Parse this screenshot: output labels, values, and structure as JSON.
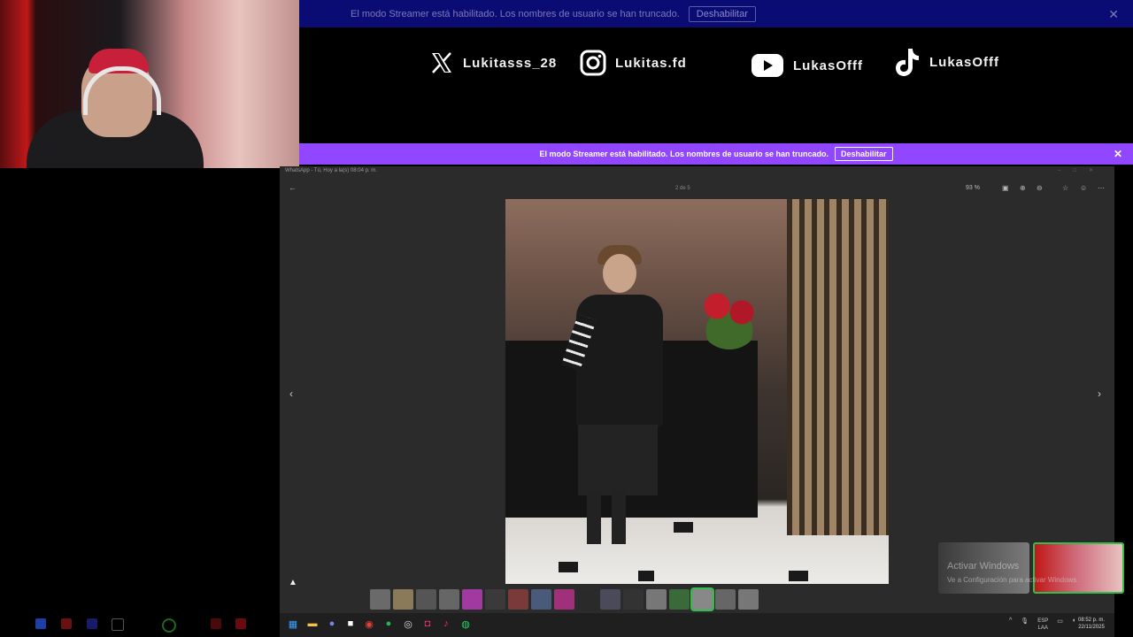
{
  "top_banner": {
    "text": "El modo Streamer está habilitado. Los nombres de usuario se han truncado.",
    "button": "Deshabilitar",
    "close": "✕"
  },
  "socials": [
    {
      "icon": "x-logo-icon",
      "label": "Lukitasss_28"
    },
    {
      "icon": "instagram-icon",
      "label": "Lukitas.fd"
    },
    {
      "icon": "youtube-icon",
      "label": "LukasOfff"
    },
    {
      "icon": "tiktok-icon",
      "label": "LukasOfff"
    }
  ],
  "purple_banner": {
    "text": "El modo Streamer está habilitado. Los nombres de usuario se han truncado.",
    "button": "Deshabilitar",
    "close": "✕",
    "color": "#9146ff"
  },
  "viewer": {
    "title": "WhatsApp - Tú, Hoy a la(s) 08:04 p. m.",
    "page_counter": "2 de 5",
    "zoom": "93 %",
    "back": "←",
    "prev": "‹",
    "next": "›"
  },
  "watermark": {
    "title": "Activar Windows",
    "subtitle": "Ve a Configuración para activar Windows."
  },
  "clock": {
    "lang1": "ESP",
    "lang2": "LAA",
    "time": "08:52 p. m.",
    "date": "22/11/2025"
  },
  "accent": {
    "selected_thumb": "#2fbf4a"
  }
}
